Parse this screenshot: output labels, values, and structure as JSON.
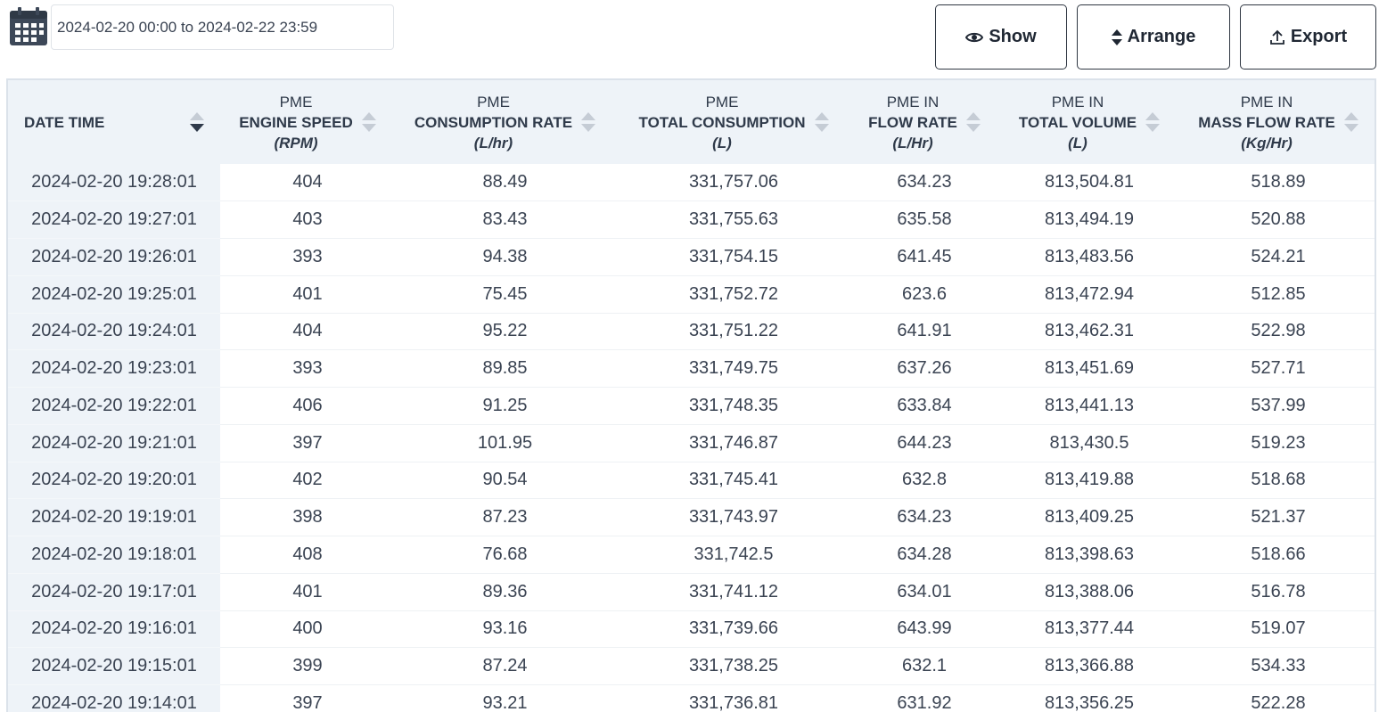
{
  "date_range": "2024-02-20 00:00 to 2024-02-22 23:59",
  "buttons": {
    "show": "Show",
    "arrange": "Arrange",
    "export": "Export"
  },
  "columns": [
    {
      "pre": "",
      "main": "DATE TIME",
      "unit": ""
    },
    {
      "pre": "PME",
      "main": "ENGINE SPEED",
      "unit": "(RPM)"
    },
    {
      "pre": "PME",
      "main": "CONSUMPTION RATE",
      "unit": "(L/hr)"
    },
    {
      "pre": "PME",
      "main": "TOTAL CONSUMPTION",
      "unit": "(L)"
    },
    {
      "pre": "PME IN",
      "main": "FLOW RATE",
      "unit": "(L/Hr)"
    },
    {
      "pre": "PME IN",
      "main": "TOTAL VOLUME",
      "unit": "(L)"
    },
    {
      "pre": "PME IN",
      "main": "MASS FLOW RATE",
      "unit": "(Kg/Hr)"
    }
  ],
  "rows": [
    [
      "2024-02-20 19:28:01",
      "404",
      "88.49",
      "331,757.06",
      "634.23",
      "813,504.81",
      "518.89"
    ],
    [
      "2024-02-20 19:27:01",
      "403",
      "83.43",
      "331,755.63",
      "635.58",
      "813,494.19",
      "520.88"
    ],
    [
      "2024-02-20 19:26:01",
      "393",
      "94.38",
      "331,754.15",
      "641.45",
      "813,483.56",
      "524.21"
    ],
    [
      "2024-02-20 19:25:01",
      "401",
      "75.45",
      "331,752.72",
      "623.6",
      "813,472.94",
      "512.85"
    ],
    [
      "2024-02-20 19:24:01",
      "404",
      "95.22",
      "331,751.22",
      "641.91",
      "813,462.31",
      "522.98"
    ],
    [
      "2024-02-20 19:23:01",
      "393",
      "89.85",
      "331,749.75",
      "637.26",
      "813,451.69",
      "527.71"
    ],
    [
      "2024-02-20 19:22:01",
      "406",
      "91.25",
      "331,748.35",
      "633.84",
      "813,441.13",
      "537.99"
    ],
    [
      "2024-02-20 19:21:01",
      "397",
      "101.95",
      "331,746.87",
      "644.23",
      "813,430.5",
      "519.23"
    ],
    [
      "2024-02-20 19:20:01",
      "402",
      "90.54",
      "331,745.41",
      "632.8",
      "813,419.88",
      "518.68"
    ],
    [
      "2024-02-20 19:19:01",
      "398",
      "87.23",
      "331,743.97",
      "634.23",
      "813,409.25",
      "521.37"
    ],
    [
      "2024-02-20 19:18:01",
      "408",
      "76.68",
      "331,742.5",
      "634.28",
      "813,398.63",
      "518.66"
    ],
    [
      "2024-02-20 19:17:01",
      "401",
      "89.36",
      "331,741.12",
      "634.01",
      "813,388.06",
      "516.78"
    ],
    [
      "2024-02-20 19:16:01",
      "400",
      "93.16",
      "331,739.66",
      "643.99",
      "813,377.44",
      "519.07"
    ],
    [
      "2024-02-20 19:15:01",
      "399",
      "87.24",
      "331,738.25",
      "632.1",
      "813,366.88",
      "534.33"
    ],
    [
      "2024-02-20 19:14:01",
      "397",
      "93.21",
      "331,736.81",
      "631.92",
      "813,356.25",
      "522.28"
    ]
  ],
  "icons": {
    "calendar": "calendar-icon",
    "show": "eye-icon",
    "arrange": "sort-icon",
    "export": "upload-icon"
  }
}
